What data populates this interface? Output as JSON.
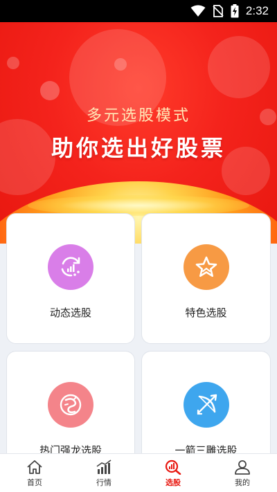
{
  "status_bar": {
    "time": "2:32"
  },
  "banner": {
    "subtitle": "多元选股模式",
    "title": "助你选出好股票"
  },
  "cards": [
    {
      "label": "动态选股",
      "icon": "refresh-chart-icon",
      "color": "#d97ee8"
    },
    {
      "label": "特色选股",
      "icon": "star-icon",
      "color": "#f79a44"
    },
    {
      "label": "热门强龙选股",
      "icon": "dragon-icon",
      "color": "#f4848a"
    },
    {
      "label": "一箭三雕选股",
      "icon": "bow-arrow-icon",
      "color": "#3ea6ee"
    }
  ],
  "tabbar": {
    "active_color": "#e8170f",
    "items": [
      {
        "label": "首页",
        "icon": "home-icon"
      },
      {
        "label": "行情",
        "icon": "bar-chart-icon"
      },
      {
        "label": "选股",
        "icon": "stock-search-icon",
        "active": true
      },
      {
        "label": "我的",
        "icon": "user-icon"
      }
    ]
  }
}
